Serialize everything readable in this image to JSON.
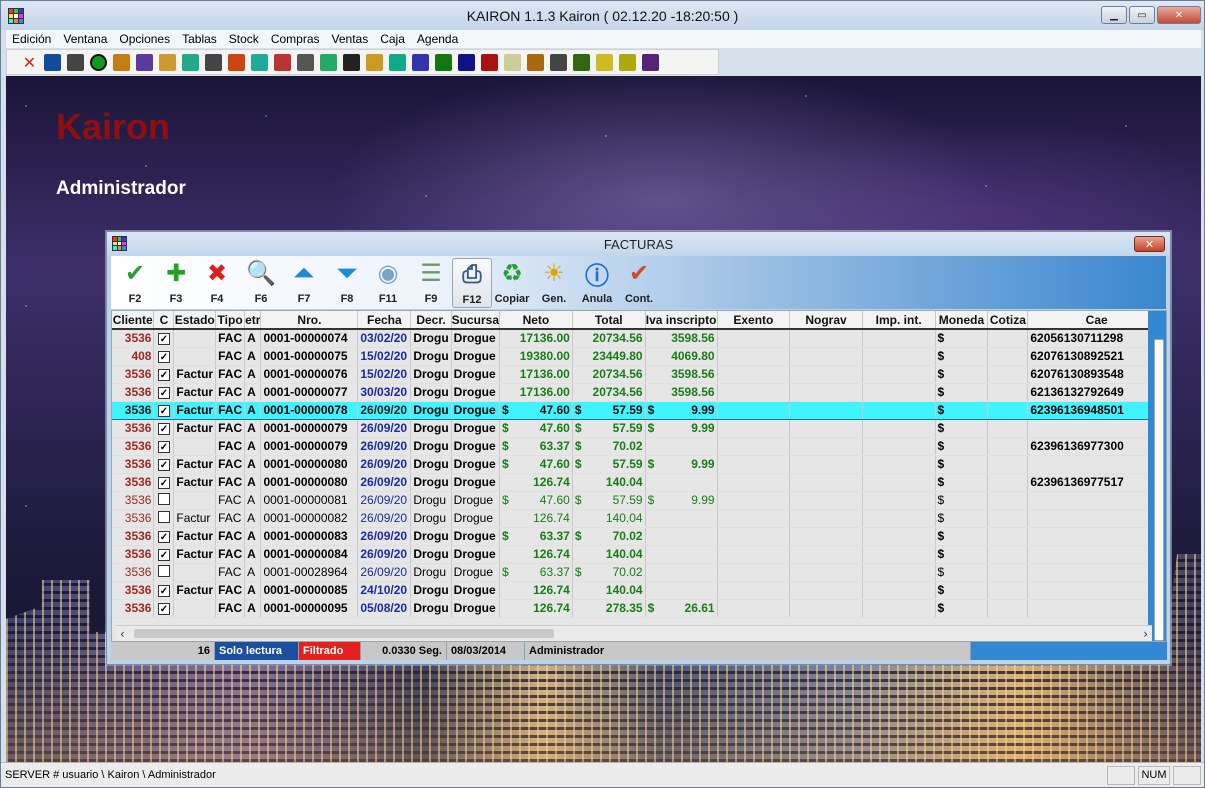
{
  "window": {
    "title": "KAIRON 1.1.3   Kairon  ( 02.12.20      -18:20:50 )"
  },
  "menu": [
    "Edición",
    "Ventana",
    "Opciones",
    "Tablas",
    "Stock",
    "Compras",
    "Ventas",
    "Caja",
    "Agenda"
  ],
  "desktop": {
    "brand": "Kairon",
    "user": "Administrador"
  },
  "statusbar": {
    "path": "SERVER # usuario \\ Kairon \\ Administrador",
    "num": "NUM"
  },
  "dialog": {
    "title": "FACTURAS",
    "close": "✕",
    "toolbar": [
      {
        "label": "F2",
        "icon": "edit-check-icon"
      },
      {
        "label": "F3",
        "icon": "add-plus-icon"
      },
      {
        "label": "F4",
        "icon": "delete-x-icon"
      },
      {
        "label": "F6",
        "icon": "search-magnifier-icon"
      },
      {
        "label": "F7",
        "icon": "arrow-up-icon"
      },
      {
        "label": "F8",
        "icon": "arrow-down-icon"
      },
      {
        "label": "F11",
        "icon": "disk-icon"
      },
      {
        "label": "F9",
        "icon": "list-icon"
      },
      {
        "label": "F12",
        "icon": "printer-icon"
      },
      {
        "label": "Copiar",
        "icon": "recycle-icon"
      },
      {
        "label": "Gen.",
        "icon": "sun-icon"
      },
      {
        "label": "Anula",
        "icon": "info-icon"
      },
      {
        "label": "Cont.",
        "icon": "check-arrow-icon"
      }
    ],
    "columns": [
      "Cliente",
      "C",
      "Estado",
      "Tipo",
      "etr",
      "Nro.",
      "Fecha",
      "Decr.",
      "Sucursa",
      "Neto",
      "Total",
      "Iva inscripto",
      "Exento",
      "Nograv",
      "Imp. int.",
      "Moneda",
      "Cotiza",
      "Cae"
    ],
    "rows": [
      {
        "cliente": "3536",
        "c": true,
        "estado": "",
        "tipo": "FAC",
        "letra": "A",
        "nro": "0001-00000074",
        "fecha": "03/02/20",
        "decr": "Drogu",
        "suc": "Drogue",
        "neto": "17136.00",
        "neto_sign": "",
        "total": "20734.56",
        "total_sign": "",
        "iva": "3598.56",
        "iva_sign": "",
        "moneda": "$",
        "cae": "62056130711298",
        "light": false,
        "selected": false
      },
      {
        "cliente": "408",
        "c": true,
        "estado": "",
        "tipo": "FAC",
        "letra": "A",
        "nro": "0001-00000075",
        "fecha": "15/02/20",
        "decr": "Drogu",
        "suc": "Drogue",
        "neto": "19380.00",
        "neto_sign": "",
        "total": "23449.80",
        "total_sign": "",
        "iva": "4069.80",
        "iva_sign": "",
        "moneda": "$",
        "cae": "62076130892521",
        "light": false,
        "selected": false
      },
      {
        "cliente": "3536",
        "c": true,
        "estado": "Factur",
        "tipo": "FAC",
        "letra": "A",
        "nro": "0001-00000076",
        "fecha": "15/02/20",
        "decr": "Drogu",
        "suc": "Drogue",
        "neto": "17136.00",
        "neto_sign": "",
        "total": "20734.56",
        "total_sign": "",
        "iva": "3598.56",
        "iva_sign": "",
        "moneda": "$",
        "cae": "62076130893548",
        "light": false,
        "selected": false
      },
      {
        "cliente": "3536",
        "c": true,
        "estado": "Factur",
        "tipo": "FAC",
        "letra": "A",
        "nro": "0001-00000077",
        "fecha": "30/03/20",
        "decr": "Drogu",
        "suc": "Drogue",
        "neto": "17136.00",
        "neto_sign": "",
        "total": "20734.56",
        "total_sign": "",
        "iva": "3598.56",
        "iva_sign": "",
        "moneda": "$",
        "cae": "62136132792649",
        "light": false,
        "selected": false
      },
      {
        "cliente": "3536",
        "c": true,
        "estado": "Factur",
        "tipo": "FAC",
        "letra": "A",
        "nro": "0001-00000078",
        "fecha": "26/09/20",
        "decr": "Drogu",
        "suc": "Drogue",
        "neto": "47.60",
        "neto_sign": "$",
        "total": "57.59",
        "total_sign": "$",
        "iva": "9.99",
        "iva_sign": "$",
        "moneda": "$",
        "cae": "62396136948501",
        "light": false,
        "selected": true
      },
      {
        "cliente": "3536",
        "c": true,
        "estado": "Factur",
        "tipo": "FAC",
        "letra": "A",
        "nro": "0001-00000079",
        "fecha": "26/09/20",
        "decr": "Drogu",
        "suc": "Drogue",
        "neto": "47.60",
        "neto_sign": "$",
        "total": "57.59",
        "total_sign": "$",
        "iva": "9.99",
        "iva_sign": "$",
        "moneda": "$",
        "cae": "",
        "light": false,
        "selected": false
      },
      {
        "cliente": "3536",
        "c": true,
        "estado": "",
        "tipo": "FAC",
        "letra": "A",
        "nro": "0001-00000079",
        "fecha": "26/09/20",
        "decr": "Drogu",
        "suc": "Drogue",
        "neto": "63.37",
        "neto_sign": "$",
        "total": "70.02",
        "total_sign": "$",
        "iva": "",
        "iva_sign": "",
        "moneda": "$",
        "cae": "62396136977300",
        "light": false,
        "selected": false
      },
      {
        "cliente": "3536",
        "c": true,
        "estado": "Factur",
        "tipo": "FAC",
        "letra": "A",
        "nro": "0001-00000080",
        "fecha": "26/09/20",
        "decr": "Drogu",
        "suc": "Drogue",
        "neto": "47.60",
        "neto_sign": "$",
        "total": "57.59",
        "total_sign": "$",
        "iva": "9.99",
        "iva_sign": "$",
        "moneda": "$",
        "cae": "",
        "light": false,
        "selected": false
      },
      {
        "cliente": "3536",
        "c": true,
        "estado": "Factur",
        "tipo": "FAC",
        "letra": "A",
        "nro": "0001-00000080",
        "fecha": "26/09/20",
        "decr": "Drogu",
        "suc": "Drogue",
        "neto": "126.74",
        "neto_sign": "",
        "total": "140.04",
        "total_sign": "",
        "iva": "",
        "iva_sign": "",
        "moneda": "$",
        "cae": "62396136977517",
        "light": false,
        "selected": false
      },
      {
        "cliente": "3536",
        "c": false,
        "estado": "",
        "tipo": "FAC",
        "letra": "A",
        "nro": "0001-00000081",
        "fecha": "26/09/20",
        "decr": "Drogu",
        "suc": "Drogue",
        "neto": "47.60",
        "neto_sign": "$",
        "total": "57.59",
        "total_sign": "$",
        "iva": "9.99",
        "iva_sign": "$",
        "moneda": "$",
        "cae": "",
        "light": true,
        "selected": false
      },
      {
        "cliente": "3536",
        "c": false,
        "estado": "Factur",
        "tipo": "FAC",
        "letra": "A",
        "nro": "0001-00000082",
        "fecha": "26/09/20",
        "decr": "Drogu",
        "suc": "Drogue",
        "neto": "126.74",
        "neto_sign": "",
        "total": "140.04",
        "total_sign": "",
        "iva": "",
        "iva_sign": "",
        "moneda": "$",
        "cae": "",
        "light": true,
        "selected": false
      },
      {
        "cliente": "3536",
        "c": true,
        "estado": "Factur",
        "tipo": "FAC",
        "letra": "A",
        "nro": "0001-00000083",
        "fecha": "26/09/20",
        "decr": "Drogu",
        "suc": "Drogue",
        "neto": "63.37",
        "neto_sign": "$",
        "total": "70.02",
        "total_sign": "$",
        "iva": "",
        "iva_sign": "",
        "moneda": "$",
        "cae": "",
        "light": false,
        "selected": false
      },
      {
        "cliente": "3536",
        "c": true,
        "estado": "Factur",
        "tipo": "FAC",
        "letra": "A",
        "nro": "0001-00000084",
        "fecha": "26/09/20",
        "decr": "Drogu",
        "suc": "Drogue",
        "neto": "126.74",
        "neto_sign": "",
        "total": "140.04",
        "total_sign": "",
        "iva": "",
        "iva_sign": "",
        "moneda": "$",
        "cae": "",
        "light": false,
        "selected": false
      },
      {
        "cliente": "3536",
        "c": false,
        "estado": "",
        "tipo": "FAC",
        "letra": "A",
        "nro": "0001-00028964",
        "fecha": "26/09/20",
        "decr": "Drogu",
        "suc": "Drogue",
        "neto": "63.37",
        "neto_sign": "$",
        "total": "70.02",
        "total_sign": "$",
        "iva": "",
        "iva_sign": "",
        "moneda": "$",
        "cae": "",
        "light": true,
        "selected": false
      },
      {
        "cliente": "3536",
        "c": true,
        "estado": "Factur",
        "tipo": "FAC",
        "letra": "A",
        "nro": "0001-00000085",
        "fecha": "24/10/20",
        "decr": "Drogu",
        "suc": "Drogue",
        "neto": "126.74",
        "neto_sign": "",
        "total": "140.04",
        "total_sign": "",
        "iva": "",
        "iva_sign": "",
        "moneda": "$",
        "cae": "",
        "light": false,
        "selected": false
      },
      {
        "cliente": "3536",
        "c": true,
        "estado": "",
        "tipo": "FAC",
        "letra": "A",
        "nro": "0001-00000095",
        "fecha": "05/08/20",
        "decr": "Drogu",
        "suc": "Drogue",
        "neto": "126.74",
        "neto_sign": "",
        "total": "278.35",
        "total_sign": "",
        "iva": "26.61",
        "iva_sign": "$",
        "moneda": "$",
        "cae": "",
        "light": false,
        "selected": false
      }
    ],
    "status": {
      "count": "16",
      "mode": "Solo lectura",
      "filter": "Filtrado",
      "time": "0.0330 Seg.",
      "date": "08/03/2014",
      "user": "Administrador"
    }
  }
}
